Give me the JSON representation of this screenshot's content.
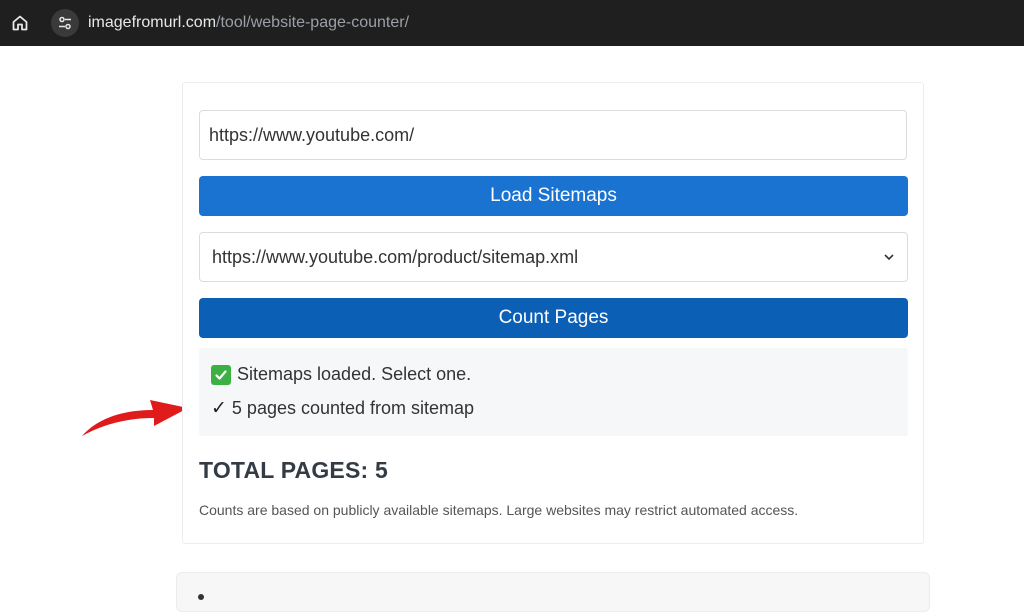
{
  "browser": {
    "url_host": "imagefromurl.com",
    "url_path": "/tool/website-page-counter/"
  },
  "tool": {
    "url_input_value": "https://www.youtube.com/",
    "load_button_label": "Load Sitemaps",
    "sitemap_selected": "https://www.youtube.com/product/sitemap.xml",
    "count_button_label": "Count Pages",
    "status": {
      "line1": "Sitemaps loaded. Select one.",
      "line2_mark": "✓",
      "line2": "5 pages counted from sitemap"
    },
    "total_pages_text": "TOTAL PAGES: 5",
    "note": "Counts are based on publicly available sitemaps. Large websites may restrict automated access."
  },
  "colors": {
    "load_button": "#1a73d1",
    "count_button": "#0b5fb5",
    "success_check": "#3cb043",
    "annotation_arrow": "#e01b1b"
  }
}
